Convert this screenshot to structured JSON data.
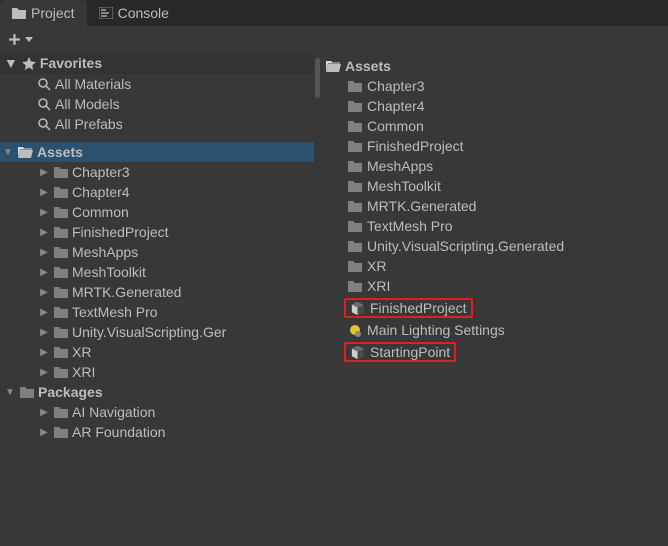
{
  "tabs": {
    "project": "Project",
    "console": "Console"
  },
  "left": {
    "favorites": {
      "label": "Favorites",
      "items": [
        "All Materials",
        "All Models",
        "All Prefabs"
      ]
    },
    "assets": {
      "label": "Assets",
      "items": [
        "Chapter3",
        "Chapter4",
        "Common",
        "FinishedProject",
        "MeshApps",
        "MeshToolkit",
        "MRTK.Generated",
        "TextMesh Pro",
        "Unity.VisualScripting.Generated",
        "XR",
        "XRI"
      ],
      "truncated_hint": "Unity.VisualScripting.Ger"
    },
    "packages": {
      "label": "Packages",
      "items": [
        "AI Navigation",
        "AR Foundation"
      ]
    }
  },
  "right": {
    "header": "Assets",
    "folders": [
      "Chapter3",
      "Chapter4",
      "Common",
      "FinishedProject",
      "MeshApps",
      "MeshToolkit",
      "MRTK.Generated",
      "TextMesh Pro",
      "Unity.VisualScripting.Generated",
      "XR",
      "XRI"
    ],
    "assets": [
      {
        "label": "FinishedProject",
        "icon": "unity",
        "highlight": true
      },
      {
        "label": "Main Lighting Settings",
        "icon": "light",
        "highlight": false
      },
      {
        "label": "StartingPoint",
        "icon": "unity",
        "highlight": true
      }
    ]
  }
}
